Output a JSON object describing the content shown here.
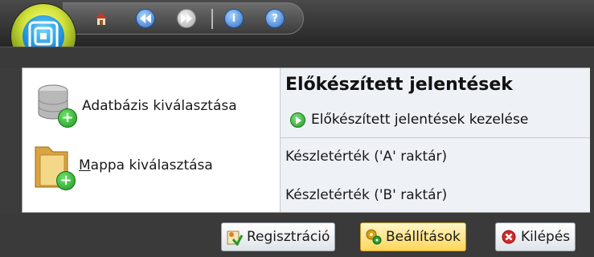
{
  "quick_access": {
    "icons": [
      "home-icon",
      "back-icon",
      "forward-icon",
      "info-icon",
      "help-icon"
    ]
  },
  "left_actions": [
    {
      "label": "Adatbázis kiválasztása",
      "icon": "database-add-icon"
    },
    {
      "label": "Mappa kiválasztása",
      "mnemonic": "M",
      "rest": "appa kiválasztása",
      "icon": "folder-add-icon"
    }
  ],
  "reports": {
    "title": "Előkészített jelentések",
    "manage_label": "Előkészített jelentések kezelése",
    "items": [
      "Készletérték ('A' raktár)",
      "Készletérték ('B' raktár)"
    ]
  },
  "bottom_buttons": [
    {
      "label": "Regisztráció",
      "icon": "registration-icon"
    },
    {
      "label": "Beállítások",
      "icon": "settings-icon",
      "active": true
    },
    {
      "label": "Kilépés",
      "icon": "exit-icon"
    }
  ],
  "colors": {
    "accent_green": "#1e9a1e",
    "active_button": "#ffd65a",
    "exit_red": "#d42a2a",
    "info_blue": "#2f7fd8"
  }
}
